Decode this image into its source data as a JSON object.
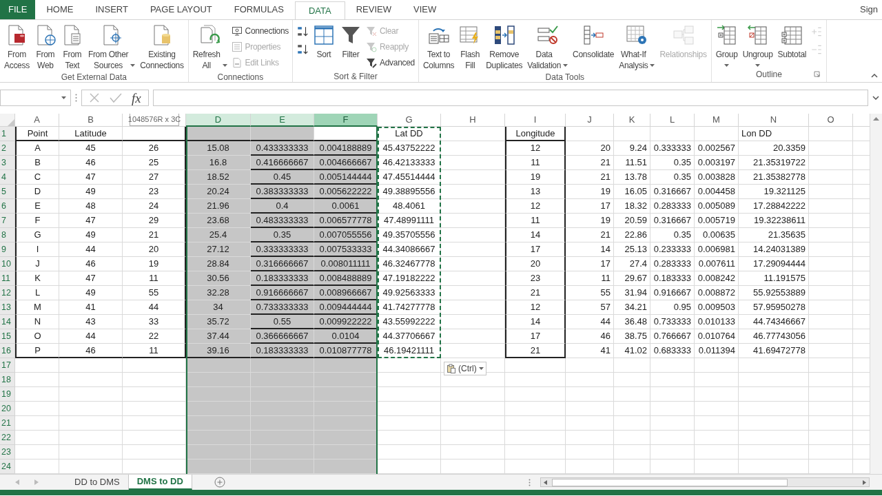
{
  "ribbon_tabs": [
    {
      "label": "FILE",
      "kind": "file",
      "selected": false
    },
    {
      "label": "HOME",
      "kind": "tab",
      "selected": false
    },
    {
      "label": "INSERT",
      "kind": "tab",
      "selected": false
    },
    {
      "label": "PAGE LAYOUT",
      "kind": "tab",
      "selected": false
    },
    {
      "label": "FORMULAS",
      "kind": "tab",
      "selected": false
    },
    {
      "label": "DATA",
      "kind": "tab",
      "selected": true
    },
    {
      "label": "REVIEW",
      "kind": "tab",
      "selected": false
    },
    {
      "label": "VIEW",
      "kind": "tab",
      "selected": false
    }
  ],
  "account": "Sign",
  "ribbon": {
    "groups": [
      {
        "label": "Get External Data",
        "items": [
          {
            "kind": "large",
            "label": "From\nAccess",
            "dropdown": false,
            "disabled": false
          },
          {
            "kind": "large",
            "label": "From\nWeb",
            "dropdown": false,
            "disabled": false
          },
          {
            "kind": "large",
            "label": "From\nText",
            "dropdown": false,
            "disabled": false
          },
          {
            "kind": "large",
            "label": "From Other\nSources",
            "dropdown": true,
            "disabled": false
          },
          {
            "kind": "large",
            "label": "Existing\nConnections",
            "dropdown": false,
            "disabled": false
          }
        ]
      },
      {
        "label": "Connections",
        "items": [
          {
            "kind": "large",
            "label": "Refresh\nAll",
            "dropdown": true,
            "disabled": false
          },
          {
            "kind": "stack",
            "items": [
              {
                "kind": "small",
                "label": "Connections",
                "disabled": false
              },
              {
                "kind": "small",
                "label": "Properties",
                "disabled": true
              },
              {
                "kind": "small",
                "label": "Edit Links",
                "disabled": true
              }
            ]
          }
        ]
      },
      {
        "label": "Sort & Filter",
        "items": [
          {
            "kind": "stack",
            "items": [
              {
                "kind": "icon",
                "disabled": false
              },
              {
                "kind": "icon",
                "disabled": false
              }
            ]
          },
          {
            "kind": "large",
            "label": "Sort",
            "dropdown": false,
            "disabled": false
          },
          {
            "kind": "large",
            "label": "Filter",
            "dropdown": false,
            "disabled": false
          },
          {
            "kind": "stack",
            "items": [
              {
                "kind": "small",
                "label": "Clear",
                "disabled": true
              },
              {
                "kind": "small",
                "label": "Reapply",
                "disabled": true
              },
              {
                "kind": "small",
                "label": "Advanced",
                "disabled": false
              }
            ]
          }
        ]
      },
      {
        "label": "Data Tools",
        "items": [
          {
            "kind": "large",
            "label": "Text to\nColumns",
            "dropdown": false,
            "disabled": false
          },
          {
            "kind": "large",
            "label": "Flash\nFill",
            "dropdown": false,
            "disabled": false
          },
          {
            "kind": "large",
            "label": "Remove\nDuplicates",
            "dropdown": false,
            "disabled": false
          },
          {
            "kind": "large",
            "label": "Data\nValidation",
            "dropdown": true,
            "disabled": false
          },
          {
            "kind": "large",
            "label": "Consolidate",
            "dropdown": false,
            "disabled": false
          },
          {
            "kind": "large",
            "label": "What-If\nAnalysis",
            "dropdown": true,
            "disabled": false
          },
          {
            "kind": "large",
            "label": "Relationships",
            "dropdown": false,
            "disabled": true
          }
        ]
      },
      {
        "label": "Outline",
        "items": [
          {
            "kind": "large",
            "label": "Group",
            "dropdown": true,
            "disabled": false
          },
          {
            "kind": "large",
            "label": "Ungroup",
            "dropdown": true,
            "disabled": false
          },
          {
            "kind": "large",
            "label": "Subtotal",
            "dropdown": false,
            "disabled": false
          },
          {
            "kind": "stack",
            "items": [
              {
                "kind": "icon",
                "disabled": true
              },
              {
                "kind": "icon",
                "disabled": true
              }
            ]
          }
        ]
      }
    ]
  },
  "formula_bar": {
    "function_label": "fx"
  },
  "sheet": {
    "selection_size": "1048576R x 3C",
    "columns": [
      {
        "label": "A",
        "selected": false,
        "active": false,
        "copied": false
      },
      {
        "label": "B",
        "selected": false,
        "active": false,
        "copied": false
      },
      {
        "selected": false,
        "active": false,
        "copied": false
      },
      {
        "label": "D",
        "selected": true,
        "active": false,
        "copied": false
      },
      {
        "label": "E",
        "selected": true,
        "active": false,
        "copied": false
      },
      {
        "label": "F",
        "selected": true,
        "active": true,
        "copied": false
      },
      {
        "label": "G",
        "selected": false,
        "active": false,
        "copied": true
      },
      {
        "label": "H",
        "selected": false,
        "active": false,
        "copied": false
      },
      {
        "label": "I",
        "selected": false,
        "active": false,
        "copied": false
      },
      {
        "label": "J",
        "selected": false,
        "active": false,
        "copied": false
      },
      {
        "label": "K",
        "selected": false,
        "active": false,
        "copied": false
      },
      {
        "label": "L",
        "selected": false,
        "active": false,
        "copied": false
      },
      {
        "label": "M",
        "selected": false,
        "active": false,
        "copied": false
      },
      {
        "label": "N",
        "selected": false,
        "active": false,
        "copied": false
      },
      {
        "label": "O",
        "selected": false,
        "active": false,
        "copied": false
      }
    ],
    "rows": [
      {
        "number": "1",
        "cells": [
          "Point",
          "Latitude",
          null,
          null,
          null,
          null,
          "Lat DD",
          null,
          "Longitude",
          null,
          null,
          null,
          null,
          "Lon DD",
          null
        ]
      },
      {
        "number": "2",
        "cells": [
          "A",
          "45",
          "26",
          "15.08",
          "0.433333333",
          "0.004188889",
          "45.43752222",
          null,
          "12",
          "20",
          "9.24",
          "0.333333",
          "0.002567",
          "20.3359",
          null
        ]
      },
      {
        "number": "3",
        "cells": [
          "B",
          "46",
          "25",
          "16.8",
          "0.416666667",
          "0.004666667",
          "46.42133333",
          null,
          "11",
          "21",
          "11.51",
          "0.35",
          "0.003197",
          "21.35319722",
          null
        ]
      },
      {
        "number": "4",
        "cells": [
          "C",
          "47",
          "27",
          "18.52",
          "0.45",
          "0.005144444",
          "47.45514444",
          null,
          "19",
          "21",
          "13.78",
          "0.35",
          "0.003828",
          "21.35382778",
          null
        ]
      },
      {
        "number": "5",
        "cells": [
          "D",
          "49",
          "23",
          "20.24",
          "0.383333333",
          "0.005622222",
          "49.38895556",
          null,
          "13",
          "19",
          "16.05",
          "0.316667",
          "0.004458",
          "19.321125",
          null
        ]
      },
      {
        "number": "6",
        "cells": [
          "E",
          "48",
          "24",
          "21.96",
          "0.4",
          "0.0061",
          "48.4061",
          null,
          "12",
          "17",
          "18.32",
          "0.283333",
          "0.005089",
          "17.28842222",
          null
        ]
      },
      {
        "number": "7",
        "cells": [
          "F",
          "47",
          "29",
          "23.68",
          "0.483333333",
          "0.006577778",
          "47.48991111",
          null,
          "11",
          "19",
          "20.59",
          "0.316667",
          "0.005719",
          "19.32238611",
          null
        ]
      },
      {
        "number": "8",
        "cells": [
          "G",
          "49",
          "21",
          "25.4",
          "0.35",
          "0.007055556",
          "49.35705556",
          null,
          "14",
          "21",
          "22.86",
          "0.35",
          "0.00635",
          "21.35635",
          null
        ]
      },
      {
        "number": "9",
        "cells": [
          "I",
          "44",
          "20",
          "27.12",
          "0.333333333",
          "0.007533333",
          "44.34086667",
          null,
          "17",
          "14",
          "25.13",
          "0.233333",
          "0.006981",
          "14.24031389",
          null
        ]
      },
      {
        "number": "10",
        "cells": [
          "J",
          "46",
          "19",
          "28.84",
          "0.316666667",
          "0.008011111",
          "46.32467778",
          null,
          "20",
          "17",
          "27.4",
          "0.283333",
          "0.007611",
          "17.29094444",
          null
        ]
      },
      {
        "number": "11",
        "cells": [
          "K",
          "47",
          "11",
          "30.56",
          "0.183333333",
          "0.008488889",
          "47.19182222",
          null,
          "23",
          "11",
          "29.67",
          "0.183333",
          "0.008242",
          "11.191575",
          null
        ]
      },
      {
        "number": "12",
        "cells": [
          "L",
          "49",
          "55",
          "32.28",
          "0.916666667",
          "0.008966667",
          "49.92563333",
          null,
          "21",
          "55",
          "31.94",
          "0.916667",
          "0.008872",
          "55.92553889",
          null
        ]
      },
      {
        "number": "13",
        "cells": [
          "M",
          "41",
          "44",
          "34",
          "0.733333333",
          "0.009444444",
          "41.74277778",
          null,
          "12",
          "57",
          "34.21",
          "0.95",
          "0.009503",
          "57.95950278",
          null
        ]
      },
      {
        "number": "14",
        "cells": [
          "N",
          "43",
          "33",
          "35.72",
          "0.55",
          "0.009922222",
          "43.55992222",
          null,
          "14",
          "44",
          "36.48",
          "0.733333",
          "0.010133",
          "44.74346667",
          null
        ]
      },
      {
        "number": "15",
        "cells": [
          "O",
          "44",
          "22",
          "37.44",
          "0.366666667",
          "0.0104",
          "44.37706667",
          null,
          "17",
          "46",
          "38.75",
          "0.766667",
          "0.010764",
          "46.77743056",
          null
        ]
      },
      {
        "number": "16",
        "cells": [
          "P",
          "46",
          "11",
          "39.16",
          "0.183333333",
          "0.010877778",
          "46.19421111",
          null,
          "21",
          "41",
          "41.02",
          "0.683333",
          "0.011394",
          "41.69472778",
          null
        ]
      },
      {
        "number": "17"
      },
      {
        "number": "18"
      },
      {
        "number": "19"
      },
      {
        "number": "20"
      },
      {
        "number": "21"
      },
      {
        "number": "22"
      },
      {
        "number": "23"
      },
      {
        "number": "24"
      }
    ],
    "paste_options": {
      "label": "(Ctrl)"
    }
  },
  "sheet_tabs": [
    {
      "label": "DD to DMS",
      "selected": false
    },
    {
      "label": "DMS to DD",
      "selected": true
    }
  ]
}
